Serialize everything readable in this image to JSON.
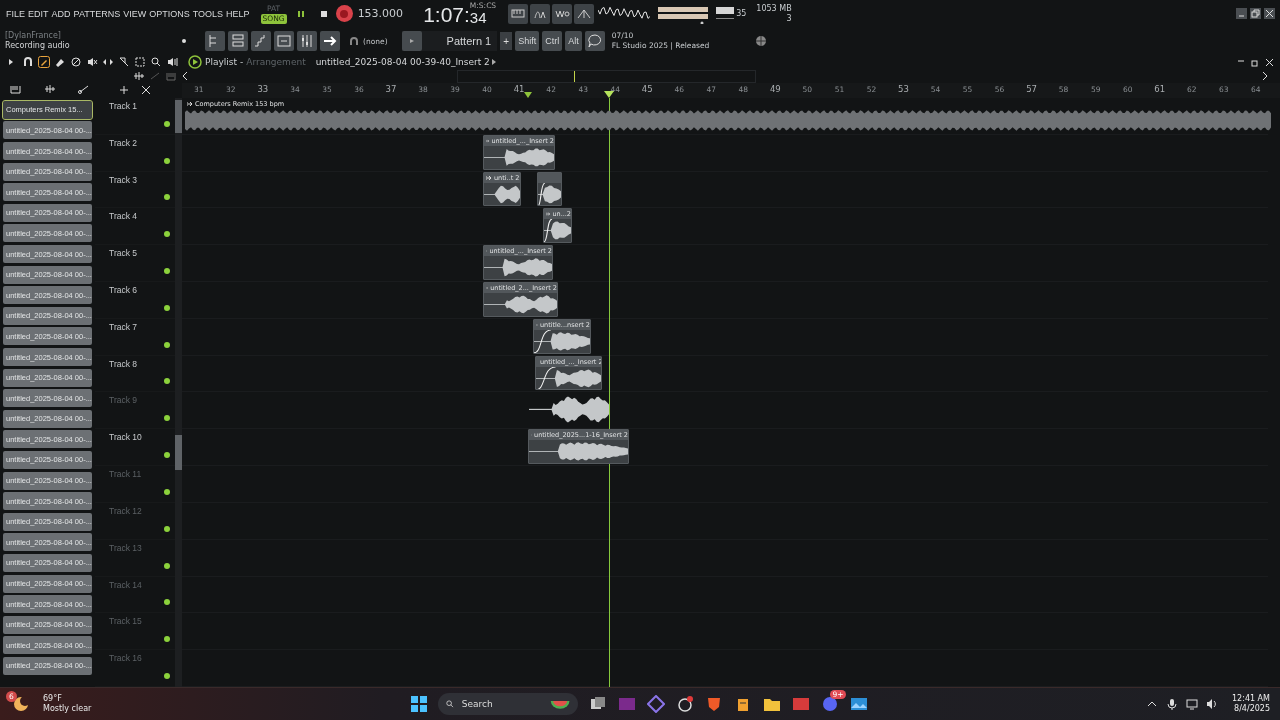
{
  "menu": [
    "FILE",
    "EDIT",
    "ADD",
    "PATTERNS",
    "VIEW",
    "OPTIONS",
    "TOOLS",
    "HELP"
  ],
  "transport": {
    "modes": [
      {
        "label": "PAT",
        "selected": false
      },
      {
        "label": "SONG",
        "selected": true
      }
    ],
    "recording": true,
    "tempo": "153.000",
    "time": "1:07:",
    "time_cs": "34",
    "time_format": "M:S:CS"
  },
  "status": {
    "cpu": "35",
    "memory": "1053 MB",
    "polyphony": "3"
  },
  "hint": {
    "user": "[DylanFrance]",
    "message": "Recording audio"
  },
  "pattern": {
    "snap": "(none)",
    "name": "Pattern 1",
    "add": "+"
  },
  "modifiers": [
    "Shift",
    "Ctrl",
    "Alt"
  ],
  "news": {
    "count": "07/10",
    "text": "FL Studio 2025 | Released"
  },
  "playlist": {
    "title": "Playlist",
    "separator": "-",
    "view": "Arrangement",
    "clip_name": "untitled_2025-08-04 00-39-40_Insert 2"
  },
  "ruler": [
    "31",
    "32",
    "33",
    "34",
    "35",
    "36",
    "37",
    "38",
    "39",
    "40",
    "41",
    "42",
    "43",
    "44",
    "45",
    "46",
    "47",
    "48",
    "49",
    "50",
    "51",
    "52",
    "53",
    "54",
    "55",
    "56",
    "57",
    "58",
    "59",
    "60",
    "61",
    "62",
    "63",
    "64"
  ],
  "clip_source": [
    {
      "label": "Computers Remix 15...",
      "selected": true
    },
    {
      "label": "untitled_2025-08-04 00-...",
      "selected": false
    },
    {
      "label": "untitled_2025-08-04 00-...",
      "selected": false
    },
    {
      "label": "untitled_2025-08-04 00-...",
      "selected": false
    },
    {
      "label": "untitled_2025-08-04 00-...",
      "selected": false
    },
    {
      "label": "untitled_2025-08-04 00-...",
      "selected": false
    },
    {
      "label": "untitled_2025-08-04 00-...",
      "selected": false
    },
    {
      "label": "untitled_2025-08-04 00-...",
      "selected": false
    },
    {
      "label": "untitled_2025-08-04 00-...",
      "selected": false
    },
    {
      "label": "untitled_2025-08-04 00-...",
      "selected": false
    },
    {
      "label": "untitled_2025-08-04 00-...",
      "selected": false
    },
    {
      "label": "untitled_2025-08-04 00-...",
      "selected": false
    },
    {
      "label": "untitled_2025-08-04 00-...",
      "selected": false
    },
    {
      "label": "untitled_2025-08-04 00-...",
      "selected": false
    },
    {
      "label": "untitled_2025-08-04 00-...",
      "selected": false
    },
    {
      "label": "untitled_2025-08-04 00-...",
      "selected": false
    },
    {
      "label": "untitled_2025-08-04 00-...",
      "selected": false
    },
    {
      "label": "untitled_2025-08-04 00-...",
      "selected": false
    },
    {
      "label": "untitled_2025-08-04 00-...",
      "selected": false
    },
    {
      "label": "untitled_2025-08-04 00-...",
      "selected": false
    },
    {
      "label": "untitled_2025-08-04 00-...",
      "selected": false
    },
    {
      "label": "untitled_2025-08-04 00-...",
      "selected": false
    },
    {
      "label": "untitled_2025-08-04 00-...",
      "selected": false
    },
    {
      "label": "untitled_2025-08-04 00-...",
      "selected": false
    },
    {
      "label": "untitled_2025-08-04 00-...",
      "selected": false
    },
    {
      "label": "untitled_2025-08-04 00-...",
      "selected": false
    },
    {
      "label": "untitled_2025-08-04 00-...",
      "selected": false
    },
    {
      "label": "untitled_2025-08-04 00-...",
      "selected": false
    }
  ],
  "tracks": [
    {
      "name": "Track 1",
      "dimmed": false,
      "enabled": true,
      "clips": [
        {
          "label": "Computers Remix 153 bpm",
          "fade_in": false
        }
      ]
    },
    {
      "name": "Track 2",
      "dimmed": false,
      "enabled": true,
      "clips": [
        {
          "label": "untitled_..._Insert 2",
          "fade_in": false
        }
      ]
    },
    {
      "name": "Track 3",
      "dimmed": false,
      "enabled": true,
      "clips": [
        {
          "label": "unti..t 2",
          "fade_in": false
        },
        {
          "fade_in": true
        }
      ]
    },
    {
      "name": "Track 4",
      "dimmed": false,
      "enabled": true,
      "clips": [
        {
          "label": "un...2",
          "fade_in": true
        }
      ]
    },
    {
      "name": "Track 5",
      "dimmed": false,
      "enabled": true,
      "clips": [
        {
          "label": "untitled_..._Insert 2",
          "fade_in": false
        }
      ]
    },
    {
      "name": "Track 6",
      "dimmed": false,
      "enabled": true,
      "clips": [
        {
          "label": "untitled_2..._Insert 2",
          "fade_in": false
        }
      ]
    },
    {
      "name": "Track 7",
      "dimmed": false,
      "enabled": true,
      "clips": [
        {
          "label": "untitle...nsert 2",
          "fade_in": true
        }
      ]
    },
    {
      "name": "Track 8",
      "dimmed": false,
      "enabled": true,
      "clips": [
        {
          "label": "untitled_..._Insert 2",
          "fade_in": true
        }
      ]
    },
    {
      "name": "Track 9",
      "dimmed": true,
      "enabled": true,
      "clips": [
        {
          "fade_in": false
        }
      ]
    },
    {
      "name": "Track 10",
      "dimmed": false,
      "enabled": true,
      "clips": [
        {
          "label": "untitled_2025...1-16_Insert 2",
          "fade_in": false
        }
      ]
    },
    {
      "name": "Track 11",
      "dimmed": true,
      "enabled": true
    },
    {
      "name": "Track 12",
      "dimmed": true,
      "enabled": true
    },
    {
      "name": "Track 13",
      "dimmed": true,
      "enabled": true
    },
    {
      "name": "Track 14",
      "dimmed": true,
      "enabled": true
    },
    {
      "name": "Track 15",
      "dimmed": true,
      "enabled": true
    },
    {
      "name": "Track 16",
      "dimmed": true,
      "enabled": true
    }
  ],
  "taskbar": {
    "weather": {
      "temp": "69°F",
      "condition": "Mostly clear",
      "badge": "6"
    },
    "search": {
      "placeholder": "Search"
    },
    "chat_badge": "9+",
    "time": "12:41 AM",
    "date": "8/4/2025"
  }
}
